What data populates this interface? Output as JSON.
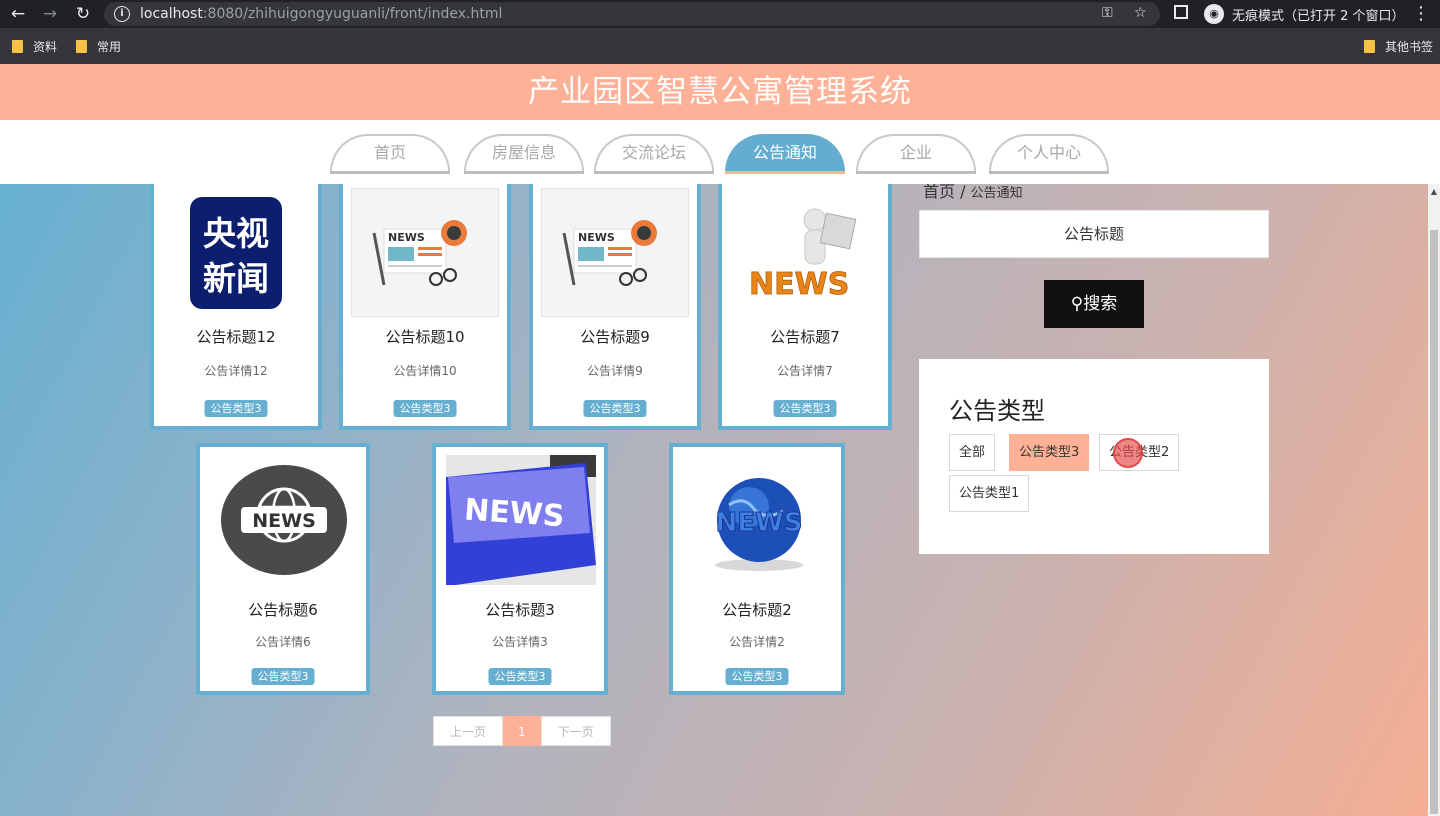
{
  "browser": {
    "url_host": "localhost",
    "url_rest": ":8080/zhihuigongyuguanli/front/index.html",
    "incognito_label": "无痕模式（已打开 2 个窗口）",
    "bookmarks": [
      "资料",
      "常用"
    ],
    "other_bookmarks": "其他书签"
  },
  "site": {
    "title": "产业园区智慧公寓管理系统",
    "nav": [
      "首页",
      "房屋信息",
      "交流论坛",
      "公告通知",
      "企业",
      "个人中心"
    ],
    "active_nav": "公告通知"
  },
  "breadcrumb": {
    "home": "首页",
    "sep": "/",
    "current": "公告通知"
  },
  "search": {
    "placeholder": "公告标题",
    "button": "搜索"
  },
  "type_filter": {
    "title": "公告类型",
    "options": [
      "全部",
      "公告类型3",
      "公告类型2",
      "公告类型1"
    ],
    "selected": "公告类型3"
  },
  "cards": [
    {
      "title": "公告标题12",
      "detail": "公告详情12",
      "type": "公告类型3",
      "image": "cctv-news"
    },
    {
      "title": "公告标题10",
      "detail": "公告详情10",
      "type": "公告类型3",
      "image": "newspaper",
      "image_text": "NEWS"
    },
    {
      "title": "公告标题9",
      "detail": "公告详情9",
      "type": "公告类型3",
      "image": "newspaper",
      "image_text": "NEWS"
    },
    {
      "title": "公告标题7",
      "detail": "公告详情7",
      "type": "公告类型3",
      "image": "news-reader",
      "image_text": "NEWS"
    },
    {
      "title": "公告标题6",
      "detail": "公告详情6",
      "type": "公告类型3",
      "image": "globe-badge",
      "image_text": "NEWS"
    },
    {
      "title": "公告标题3",
      "detail": "公告详情3",
      "type": "公告类型3",
      "image": "news-key",
      "image_text": "NEWS"
    },
    {
      "title": "公告标题2",
      "detail": "公告详情2",
      "type": "公告类型3",
      "image": "news-globe",
      "image_text": "NEWS"
    }
  ],
  "cctv_logo_text": [
    "央视",
    "新闻"
  ],
  "pager": {
    "prev": "上一页",
    "current": "1",
    "next": "下一页"
  },
  "colors": {
    "header": "#feb197",
    "accent": "#67afd0"
  }
}
